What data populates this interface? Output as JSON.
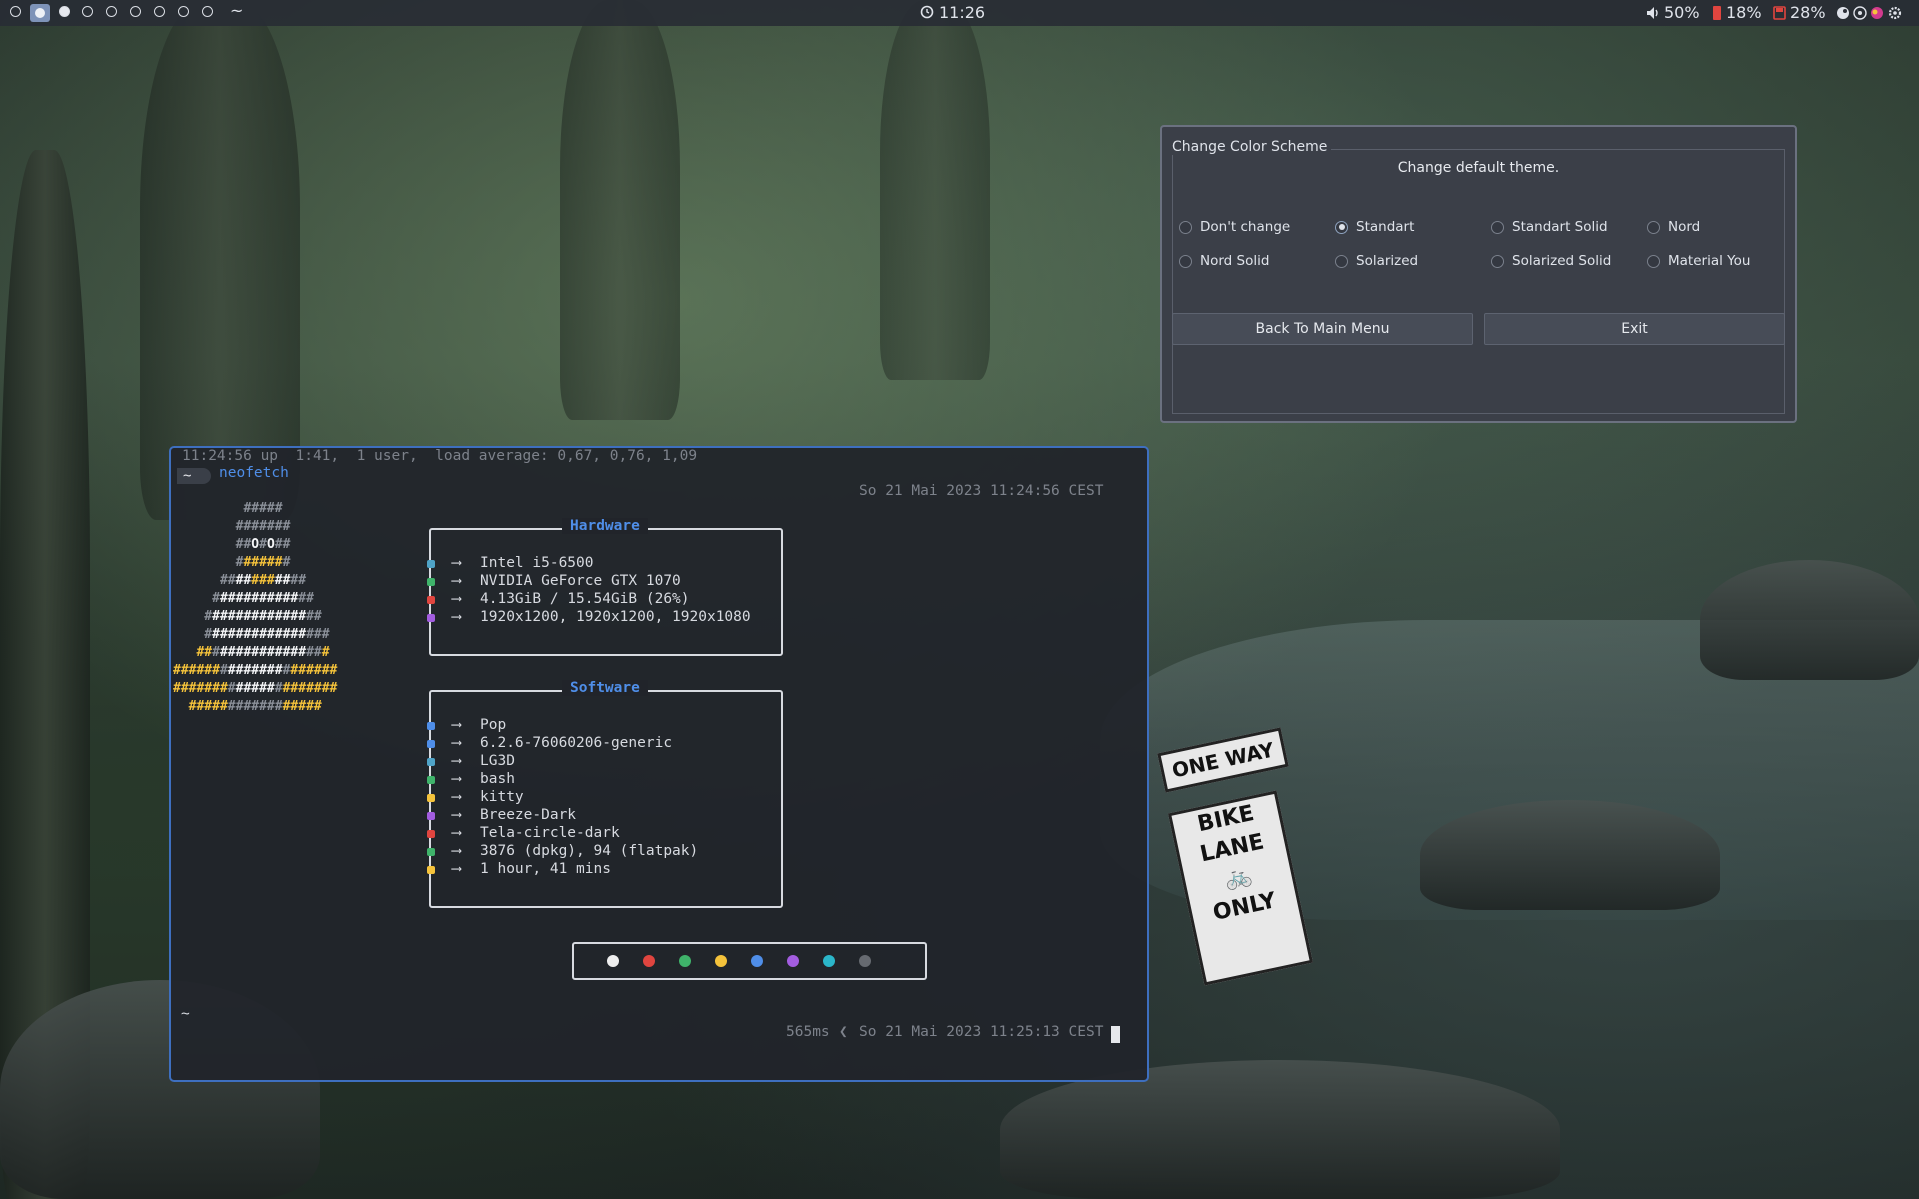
{
  "topbar": {
    "home_symbol": "~",
    "clock": "11:26",
    "volume": "50%",
    "battery": "18%",
    "disk": "28%",
    "icons": [
      "clock-icon",
      "volume-icon",
      "battery-icon",
      "disk-icon",
      "steam-icon",
      "obs-icon",
      "color-app-icon",
      "gear-icon"
    ]
  },
  "dialog": {
    "title": "Change Color Scheme",
    "subtitle": "Change default theme.",
    "options": [
      {
        "label": "Don't change",
        "checked": false
      },
      {
        "label": "Standart",
        "checked": true
      },
      {
        "label": "Standart Solid",
        "checked": false
      },
      {
        "label": "Nord",
        "checked": false
      },
      {
        "label": "Nord Solid",
        "checked": false
      },
      {
        "label": "Solarized",
        "checked": false
      },
      {
        "label": "Solarized Solid",
        "checked": false
      },
      {
        "label": "Material You",
        "checked": false
      }
    ],
    "back_button": "Back To Main Menu",
    "exit_button": "Exit"
  },
  "terminal": {
    "uptime_line": "11:24:56 up  1:41,  1 user,  load average: 0,67, 0,76, 1,09",
    "prompt_symbol": "~",
    "command": "neofetch",
    "timestamp_top": "So 21 Mai 2023 11:24:56 CEST",
    "hardware_title": "Hardware",
    "software_title": "Software",
    "arrow": "⟶",
    "hardware": [
      {
        "icon": "cpu-icon",
        "color": "#4fa3c7",
        "value": "Intel i5-6500"
      },
      {
        "icon": "gpu-icon",
        "color": "#3fb36a",
        "value": "NVIDIA GeForce GTX 1070"
      },
      {
        "icon": "memory-icon",
        "color": "#e0453f",
        "value": "4.13GiB / 15.54GiB (26%)"
      },
      {
        "icon": "display-icon",
        "color": "#a35de0",
        "value": "1920x1200, 1920x1200, 1920x1080"
      }
    ],
    "software": [
      {
        "icon": "os-icon",
        "color": "#4f8ee8",
        "value": "Pop"
      },
      {
        "icon": "kernel-icon",
        "color": "#4f8ee8",
        "value": "6.2.6-76060206-generic"
      },
      {
        "icon": "de-icon",
        "color": "#4fa3c7",
        "value": "LG3D"
      },
      {
        "icon": "shell-icon",
        "color": "#3fb36a",
        "value": "bash"
      },
      {
        "icon": "terminal-icon",
        "color": "#f5c33b",
        "value": "kitty"
      },
      {
        "icon": "theme-icon",
        "color": "#a35de0",
        "value": "Breeze-Dark"
      },
      {
        "icon": "icons-icon",
        "color": "#e0453f",
        "value": "Tela-circle-dark"
      },
      {
        "icon": "packages-icon",
        "color": "#3fb36a",
        "value": "3876 (dpkg), 94 (flatpak)"
      },
      {
        "icon": "uptime-icon",
        "color": "#f5c33b",
        "value": "1 hour, 41 mins"
      }
    ],
    "palette": [
      "#eeeeee",
      "#e0453f",
      "#3fb36a",
      "#f5c33b",
      "#4f8ee8",
      "#a35de0",
      "#2bb6c9",
      "#666a70"
    ],
    "bottom_prompt": "~",
    "duration": "565ms",
    "separator": "❮",
    "timestamp_bottom": "So 21 Mai 2023 11:25:13 CEST"
  },
  "colors": {
    "accent": "#4f8ee8",
    "terminal_border": "#3e6fbf",
    "ascii_yellow": "#f5c33b"
  }
}
